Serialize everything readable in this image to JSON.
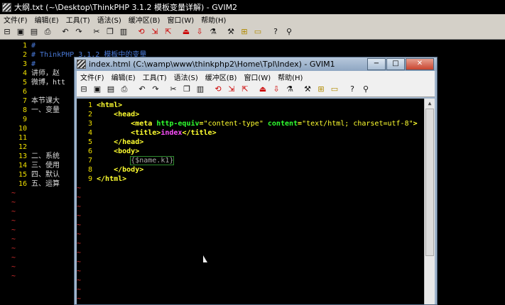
{
  "back_window": {
    "title": "大纲.txt (~\\Desktop\\ThinkPHP 3.1.2 模板变量详解) - GVIM2",
    "menu": [
      "文件(F)",
      "编辑(E)",
      "工具(T)",
      "语法(S)",
      "缓冲区(B)",
      "窗口(W)",
      "帮助(H)"
    ],
    "lines": [
      {
        "n": "1",
        "text": "#"
      },
      {
        "n": "2",
        "text": "# ThinkPHP 3.1.2 模板中的变量"
      },
      {
        "n": "3",
        "text": "#"
      },
      {
        "n": "4",
        "text": "讲师，赵"
      },
      {
        "n": "5",
        "text": "微博，htt"
      },
      {
        "n": "6",
        "text": ""
      },
      {
        "n": "7",
        "text": "本节课大"
      },
      {
        "n": "8",
        "text": "一、变量"
      },
      {
        "n": "9",
        "text": ""
      },
      {
        "n": "10",
        "text": ""
      },
      {
        "n": "11",
        "text": ""
      },
      {
        "n": "12",
        "text": ""
      },
      {
        "n": "13",
        "text": "二、系统"
      },
      {
        "n": "14",
        "text": "三、使用"
      },
      {
        "n": "15",
        "text": "四、默认"
      },
      {
        "n": "16",
        "text": "五、运算"
      }
    ]
  },
  "front_window": {
    "title": "index.html (C:\\wamp\\www\\thinkphp2\\Home\\Tpl\\Index) - GVIM1",
    "menu": [
      "文件(F)",
      "编辑(E)",
      "工具(T)",
      "语法(S)",
      "缓冲区(B)",
      "窗口(W)",
      "帮助(H)"
    ],
    "buttons": {
      "minimize": "−",
      "maximize": "□",
      "close": "✕"
    },
    "code": {
      "l1": {
        "n": "1",
        "tag": "<html>"
      },
      "l2": {
        "n": "2",
        "tag": "<head>"
      },
      "l3": {
        "n": "3",
        "open": "<meta",
        "attr1": "http-equiv",
        "eq1": "=",
        "val1": "\"content-type\"",
        "attr2": "content",
        "eq2": "=",
        "val2": "\"text/html; charset=utf-8\"",
        "close": ">"
      },
      "l4": {
        "n": "4",
        "open": "<title>",
        "text": "index",
        "close": "</title>"
      },
      "l5": {
        "n": "5",
        "tag": "</head>"
      },
      "l6": {
        "n": "6",
        "tag": "<body>"
      },
      "l7": {
        "n": "7",
        "text": "{$name.k1}"
      },
      "l8": {
        "n": "8",
        "tag": "</body>"
      },
      "l9": {
        "n": "9",
        "tag": "</html>"
      }
    }
  },
  "toolbar_icons": [
    "open-icon",
    "save-icon",
    "save-all-icon",
    "print-icon",
    "undo-icon",
    "redo-icon",
    "cut-icon",
    "copy-icon",
    "paste-icon",
    "replace-icon",
    "find-next-icon",
    "find-prev-icon",
    "load-session-icon",
    "save-session-icon",
    "run-script-icon",
    "make-icon",
    "tag-icon",
    "tag-jump-icon",
    "help-icon",
    "find-help-icon"
  ],
  "empty_line_marker": "~"
}
